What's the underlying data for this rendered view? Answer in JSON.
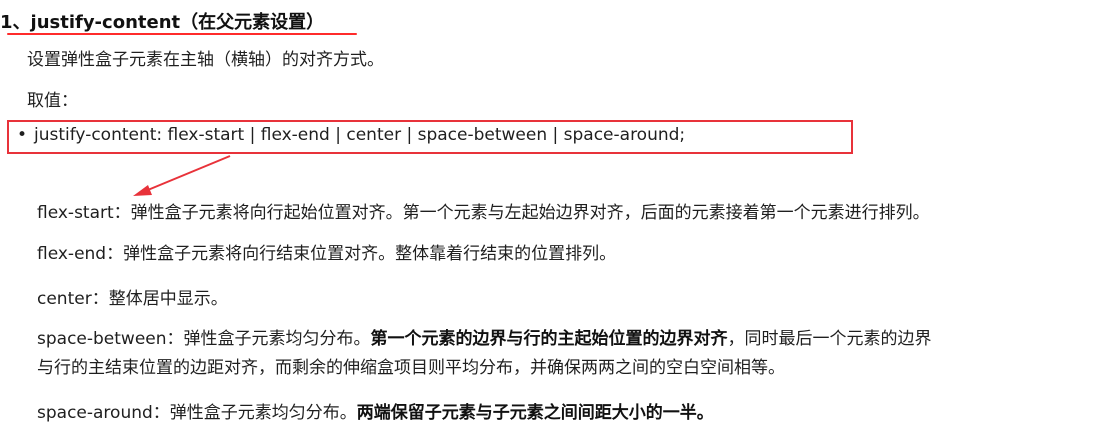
{
  "section": {
    "heading": "1、justify-content（在父元素设置）",
    "subtitle": "设置弹性盒子元素在主轴（横轴）的对齐方式。",
    "values_label": "取值：",
    "syntax": "justify-content: flex-start | flex-end | center | space-between | space-around;"
  },
  "annotations": {
    "underline_color": "#ff2b2b",
    "box_color": "#e8323a",
    "arrow_color": "#e8323a"
  },
  "descriptions": [
    {
      "term": "flex-start",
      "text": "：弹性盒子元素将向行起始位置对齐。第一个元素与左起始边界对齐，后面的元素接着第一个元素进行排列。"
    },
    {
      "term": "flex-end",
      "text": "：弹性盒子元素将向行结束位置对齐。整体靠着行结束的位置排列。"
    },
    {
      "term": "center",
      "text": "：整体居中显示。"
    },
    {
      "term": "space-between",
      "text": "：弹性盒子元素均匀分布。",
      "bold": "第一个元素的边界与行的主起始位置的边界对齐",
      "tail": "，同时最后一个元素的边界",
      "line2": "与行的主结束位置的边距对齐，而剩余的伸缩盒项目则平均分布，并确保两两之间的空白空间相等。"
    },
    {
      "term": "space-around",
      "text": "：弹性盒子元素均匀分布。",
      "bold": "两端保留子元素与子元素之间间距大小的一半。"
    }
  ]
}
